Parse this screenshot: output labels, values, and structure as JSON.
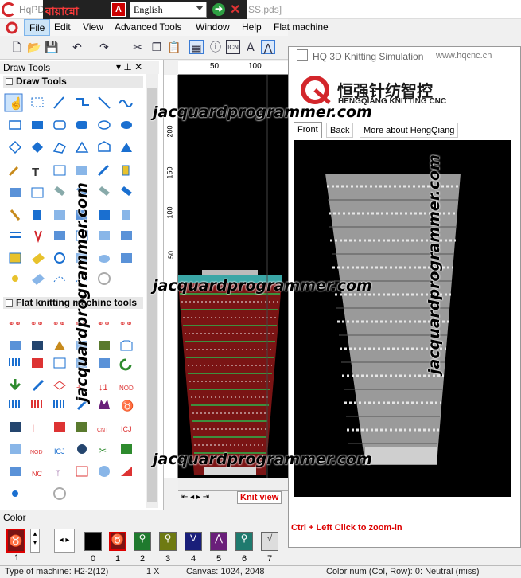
{
  "app": {
    "title_visible": "HqPD",
    "file_suffix": "SS.pds]",
    "bangla": "বায়ান্নো",
    "language": "English",
    "pdf_label": "A"
  },
  "menu": [
    "File",
    "Edit",
    "View",
    "Advanced Tools",
    "Window",
    "Help",
    "Flat machine"
  ],
  "panels": {
    "draw_tools_header": "Draw Tools",
    "section_draw": "Draw Tools",
    "section_flat": "Flat knitting machine tools"
  },
  "ruler": {
    "tick_50": "50",
    "tick_100": "100",
    "left_labels": [
      "200",
      "150",
      "100",
      "50"
    ]
  },
  "tabs": {
    "knit_view": "Knit view"
  },
  "sim": {
    "title": "HQ 3D Knitting Simulation",
    "url": "www.hqcnc.cn",
    "brand_cn": "恒强针纺智控",
    "brand_en": "HENGQIANG KNITTING CNC",
    "tabs": [
      "Front",
      "Back",
      "More about HengQiang"
    ],
    "hint": "Ctrl + Left Click to zoom-in"
  },
  "color": {
    "label": "Color",
    "swatch_numbers": [
      "1",
      "0",
      "1",
      "2",
      "3",
      "4",
      "5",
      "6",
      "7"
    ],
    "left_number": "1"
  },
  "status": {
    "machine": "Type of machine: H2-2(12)",
    "zoom": "1 X",
    "canvas": "Canvas: 1024, 2048",
    "colornum": "Color num  (Col, Row): 0: Neutral (miss)"
  },
  "watermark": "jacquardprogrammer.com",
  "colors": {
    "accent": "#d3262b",
    "swatch_dark_red": "#7a1414",
    "swatch_green": "#1f7a2e",
    "swatch_olive": "#6e7a12",
    "swatch_navy": "#1a1f7a",
    "swatch_purple": "#6a1f7a",
    "swatch_teal": "#1f7a6e"
  }
}
